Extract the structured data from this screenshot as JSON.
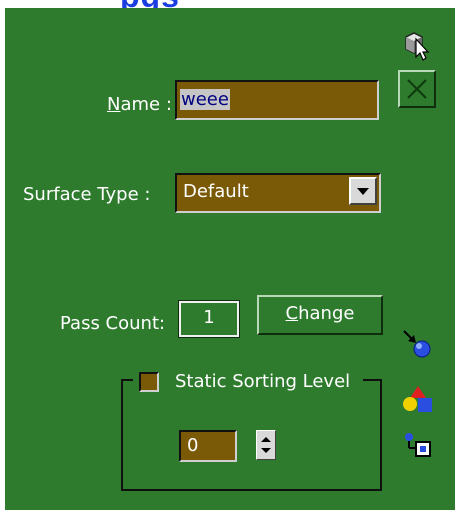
{
  "header": {
    "partial_title": "pgs"
  },
  "name": {
    "label_underlined": "N",
    "label_rest": "ame :",
    "value": "weee"
  },
  "surface_type": {
    "label": "Surface Type :",
    "selected": "Default"
  },
  "pass_count": {
    "label": "Pass Count:",
    "value": "1",
    "change_underlined": "C",
    "change_rest": "hange"
  },
  "static_sorting": {
    "label": "Static Sorting Level",
    "value": "0"
  },
  "icons": {
    "top_right_1": "cursor-select-icon",
    "top_right_2": "close-x-icon",
    "side_1": "add-arrow-sphere-icon",
    "side_2": "colored-shapes-icon",
    "side_3": "copy-cube-icon"
  },
  "colors": {
    "panel_bg": "#2e7b2e",
    "field_bg": "#7a5a07",
    "text": "#ffffff"
  }
}
